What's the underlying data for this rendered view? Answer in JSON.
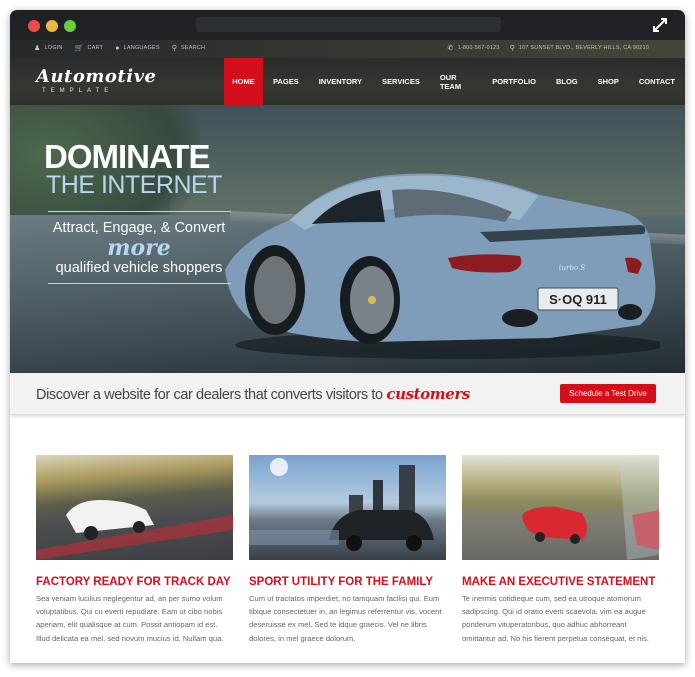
{
  "window": {
    "controls": [
      "close",
      "minimize",
      "zoom"
    ],
    "expand_icon": "expand-arrows-icon"
  },
  "topbar": {
    "links": [
      {
        "icon": "user-icon",
        "label": "LOGIN"
      },
      {
        "icon": "cart-icon",
        "label": "CART"
      },
      {
        "icon": "globe-icon",
        "label": "LANGUAGES"
      },
      {
        "icon": "search-icon",
        "label": "SEARCH"
      }
    ],
    "phone": {
      "icon": "phone-icon",
      "label": "1-800-567-0123"
    },
    "address": {
      "icon": "map-pin-icon",
      "label": "107 SUNSET BLVD., BEVERLY HILLS, CA 90210"
    }
  },
  "logo": {
    "script": "Automotive",
    "sub": "TEMPLATE"
  },
  "nav": {
    "items": [
      "HOME",
      "PAGES",
      "INVENTORY",
      "SERVICES",
      "OUR TEAM",
      "PORTFOLIO",
      "BLOG",
      "SHOP",
      "CONTACT"
    ],
    "active": "HOME"
  },
  "hero": {
    "headline": "DOMINATE",
    "subheadline": "THE INTERNET",
    "line1": "Attract, Engage, & Convert",
    "line2": "more",
    "line3": "qualified vehicle shoppers",
    "plate": "S·OQ 911",
    "badge": "turbo S"
  },
  "cta": {
    "text": "Discover a website for car dealers that converts visitors to",
    "accent": "customers",
    "button": "Schedule a Test Drive"
  },
  "cards": [
    {
      "title": "FACTORY READY FOR TRACK DAY",
      "body": "Sea veniam lucilius neglegentur ad, an per sumo volum voluptatibus. Qui cu everti repudiare. Eam ut cibo nobis aperiam, elit qualisque at cum. Possit antiopam id est. Illud delicata ea mel, sed novum mucius id. Nullam qua."
    },
    {
      "title": "SPORT UTILITY FOR THE FAMILY",
      "body": "Cum ut tractatos imperdiet, no tamquam facilisi qui. Eum tibique consectetuer in, an legimus referrentur vis, vocent deseruisse ex mel. Sed te idque graecis. Vel ne libris dolores, in mel graece dolorum."
    },
    {
      "title": "MAKE AN EXECUTIVE STATEMENT",
      "body": "Te inermis cotidieque cum, sed ea utroque atomorum sadipscing. Qui id oratio everti scaevola, vim ea augue ponderum vituperatoribus, quo adhuc abhorreant omittantur ad. No his fierent perpetua consequat, et nis."
    }
  ],
  "colors": {
    "accent": "#d30f1c",
    "hero_light": "#b6d7ef",
    "titlebar": "#1f2125"
  }
}
